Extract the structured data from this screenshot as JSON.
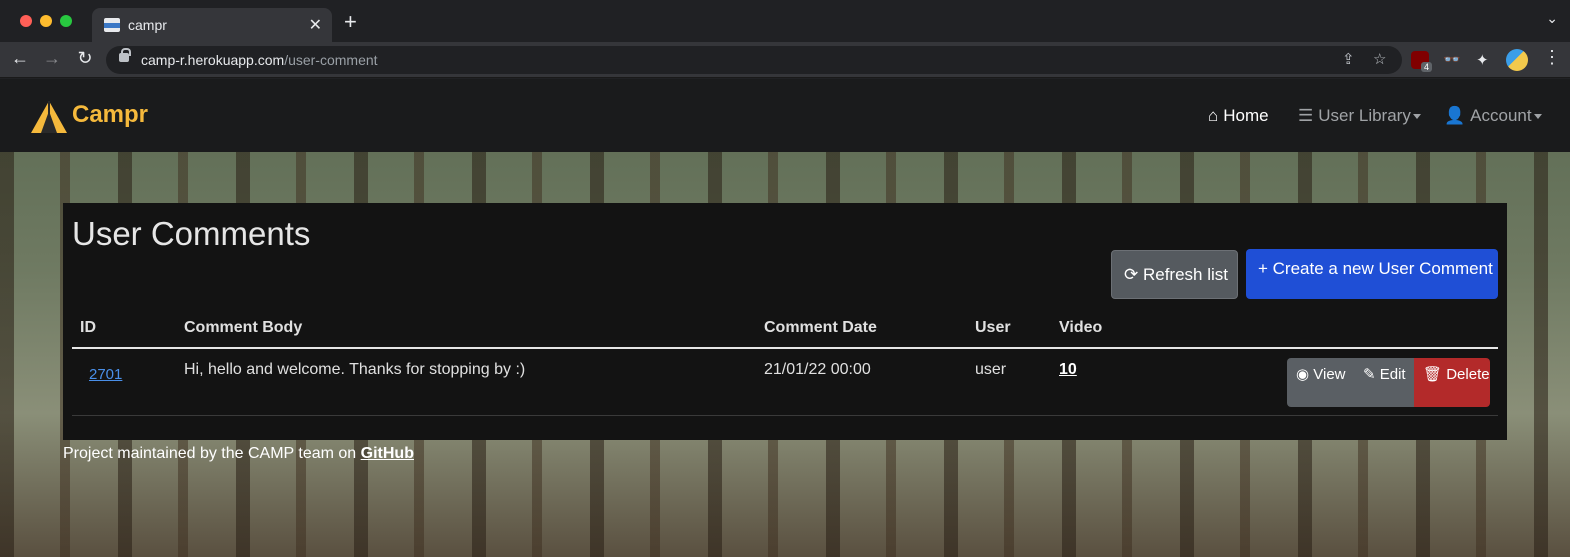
{
  "browser": {
    "tab_title": "campr",
    "url_host": "camp-r.herokuapp.com",
    "url_path": "/user-comment",
    "extension_badge": "4"
  },
  "navbar": {
    "brand": "Campr",
    "home_label": "Home",
    "library_label": "User Library",
    "account_label": "Account"
  },
  "main": {
    "title": "User Comments",
    "refresh_label": "Refresh list",
    "create_label": "Create a new User Comment",
    "table": {
      "headers": [
        "ID",
        "Comment Body",
        "Comment Date",
        "User",
        "Video"
      ],
      "rows": [
        {
          "id": "2701",
          "body": "Hi, hello and welcome. Thanks for stopping by :)",
          "date": "21/01/22 00:00",
          "user": "user",
          "video": "10"
        }
      ],
      "actions": {
        "view": "View",
        "edit": "Edit",
        "delete": "Delete"
      }
    }
  },
  "footer": {
    "text": "Project maintained by the CAMP team on ",
    "link": "GitHub"
  },
  "colors": {
    "brand": "#f5b93c",
    "create_button": "#1f4fd6",
    "delete_button": "#b32a2a",
    "link": "#4a8fe8"
  }
}
